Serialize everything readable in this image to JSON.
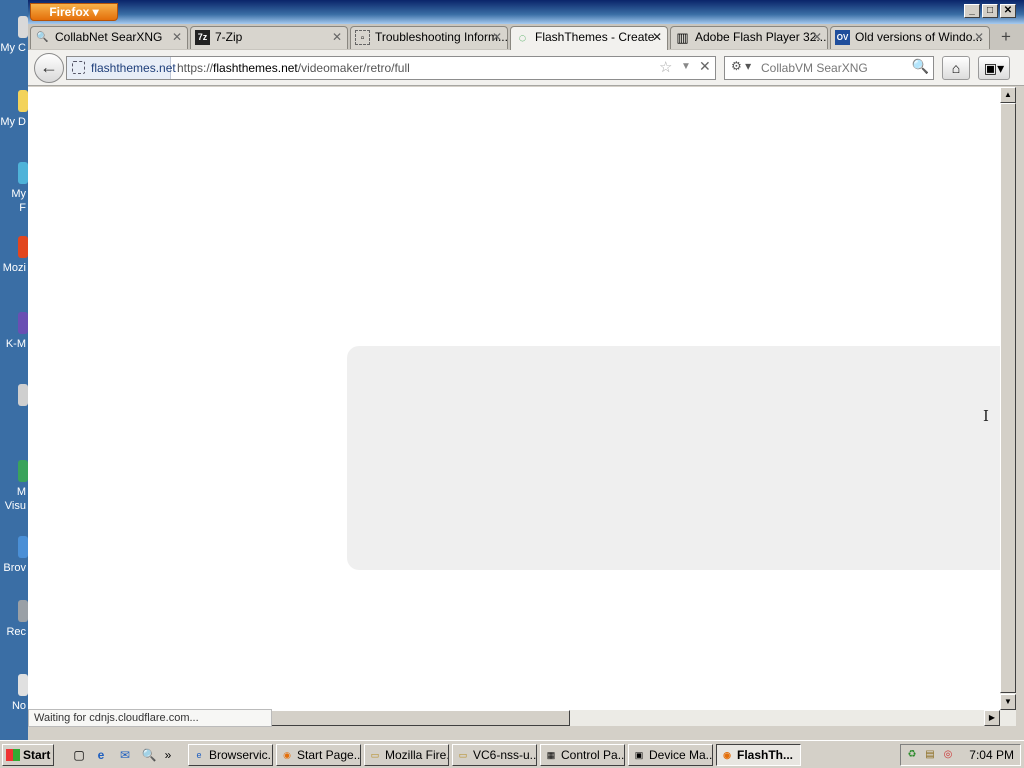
{
  "desktop": {
    "icons": [
      {
        "label": "My C",
        "color": "#d9d9d9"
      },
      {
        "label": "My D",
        "color": "#f3d35b"
      },
      {
        "label": "My",
        "label2": "F",
        "color": "#4fb3d9"
      },
      {
        "label": "Mozi",
        "color": "#e2461f"
      },
      {
        "label": "K-M",
        "color": "#6a4fb3"
      },
      {
        "label": "",
        "color": "#cfcfcf"
      },
      {
        "label": "M",
        "label2": "Visu",
        "color": "#3aa35b"
      },
      {
        "label": "Brov",
        "color": "#4a8fd6"
      },
      {
        "label": "Rec",
        "color": "#9aa0a6"
      },
      {
        "label": "No",
        "color": "#e0e0e0"
      }
    ]
  },
  "window": {
    "app_button": "Firefox ▾",
    "controls": {
      "minimize": "_",
      "maximize": "□",
      "close": "✕"
    }
  },
  "tabs": [
    {
      "label": "CollabNet SearXNG",
      "icon": "search-icon",
      "glyph": "🔍",
      "active": false
    },
    {
      "label": "7-Zip",
      "icon": "7zip-icon",
      "glyph": "7z",
      "active": false
    },
    {
      "label": "Troubleshooting Inform...",
      "icon": "page-icon",
      "glyph": "▫",
      "active": false
    },
    {
      "label": "FlashThemes - Create",
      "icon": "loading-spinner-icon",
      "glyph": "◌",
      "active": true
    },
    {
      "label": "Adobe Flash Player 32...",
      "icon": "archive-icon",
      "glyph": "▥",
      "active": false
    },
    {
      "label": "Old versions of Windo...",
      "icon": "oldversion-icon",
      "glyph": "OV",
      "active": false
    }
  ],
  "tab_close": "✕",
  "new_tab": "+",
  "nav": {
    "back": "←",
    "site_identity": "flashthemes.net",
    "url_prefix": "https://",
    "url_domain": "flashthemes.net",
    "url_path": "/videomaker/retro/full",
    "bookmark_star": "☆",
    "dropdown": "▼",
    "stop": "✕",
    "search_engine": "⚙ ▾",
    "search_placeholder": "CollabVM SearXNG",
    "search_icon": "🔍",
    "home": "⌂",
    "addons": "▣▾"
  },
  "status_text": "Waiting for cdnjs.cloudflare.com...",
  "scroll": {
    "up": "▲",
    "down": "▼",
    "right": "▶"
  },
  "taskbar": {
    "start_label": "Start",
    "quicklaunch": [
      "▢",
      "e",
      "✉",
      "🔍",
      "»"
    ],
    "items": [
      {
        "label": "Browservic...",
        "glyph": "e",
        "active": false
      },
      {
        "label": "Start Page...",
        "glyph": "◉",
        "active": false
      },
      {
        "label": "Mozilla Fire...",
        "glyph": "▭",
        "active": false
      },
      {
        "label": "VC6-nss-u...",
        "glyph": "▭",
        "active": false
      },
      {
        "label": "Control Pa...",
        "glyph": "▦",
        "active": false
      },
      {
        "label": "Device Ma...",
        "glyph": "▣",
        "active": false
      },
      {
        "label": "FlashTh...",
        "glyph": "◉",
        "active": true
      }
    ],
    "tray_icons": [
      "♻",
      "▤",
      "◎"
    ],
    "clock": "7:04 PM"
  },
  "colors": {
    "desktop": "#3a6ea5",
    "title_start": "#0a246a",
    "firefox_orange": "#e46f0a",
    "panel": "#efefef"
  }
}
